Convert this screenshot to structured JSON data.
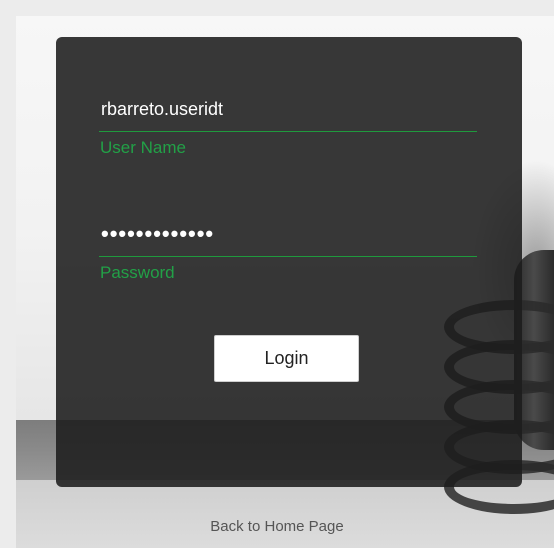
{
  "login": {
    "username_value": "rbarreto.useridt",
    "username_label": "User Name",
    "password_value": "•••••••••••••",
    "password_label": "Password",
    "login_button": "Login"
  },
  "footer": {
    "back_link": "Back to Home Page"
  },
  "colors": {
    "accent_green": "#22a047",
    "panel_background": "#1c1c1c",
    "button_background": "#ffffff"
  }
}
